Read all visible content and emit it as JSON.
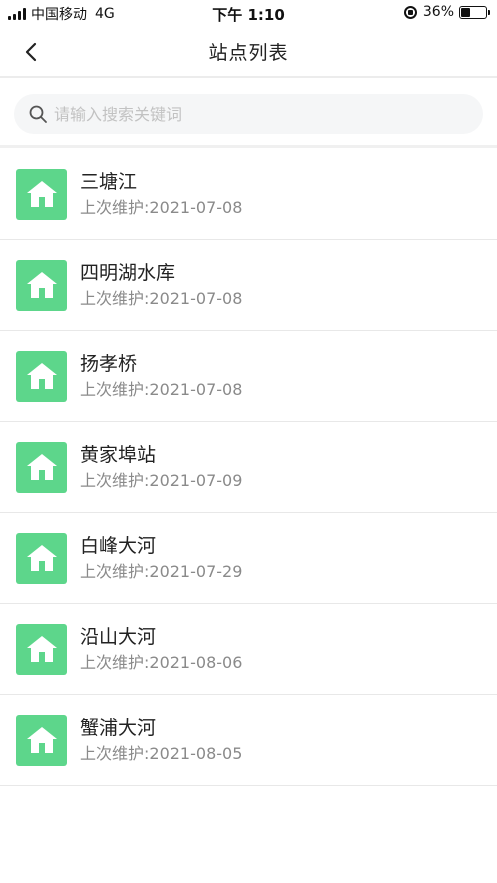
{
  "status_bar": {
    "carrier": "中国移动",
    "network": "4G",
    "time": "下午 1:10",
    "battery": "36%",
    "battery_level": 0.36
  },
  "nav": {
    "title": "站点列表",
    "back_icon": "chevron-left-icon"
  },
  "search": {
    "placeholder": "请输入搜索关键词",
    "icon": "search-icon"
  },
  "colors": {
    "accent": "#5dd68b"
  },
  "stations": [
    {
      "name": "三塘江",
      "maintenance": "上次维护:2021-07-08"
    },
    {
      "name": "四明湖水库",
      "maintenance": "上次维护:2021-07-08"
    },
    {
      "name": "扬孝桥",
      "maintenance": "上次维护:2021-07-08"
    },
    {
      "name": "黄家埠站",
      "maintenance": "上次维护:2021-07-09"
    },
    {
      "name": "白峰大河",
      "maintenance": "上次维护:2021-07-29"
    },
    {
      "name": "沿山大河",
      "maintenance": "上次维护:2021-08-06"
    },
    {
      "name": "蟹浦大河",
      "maintenance": "上次维护:2021-08-05"
    }
  ]
}
